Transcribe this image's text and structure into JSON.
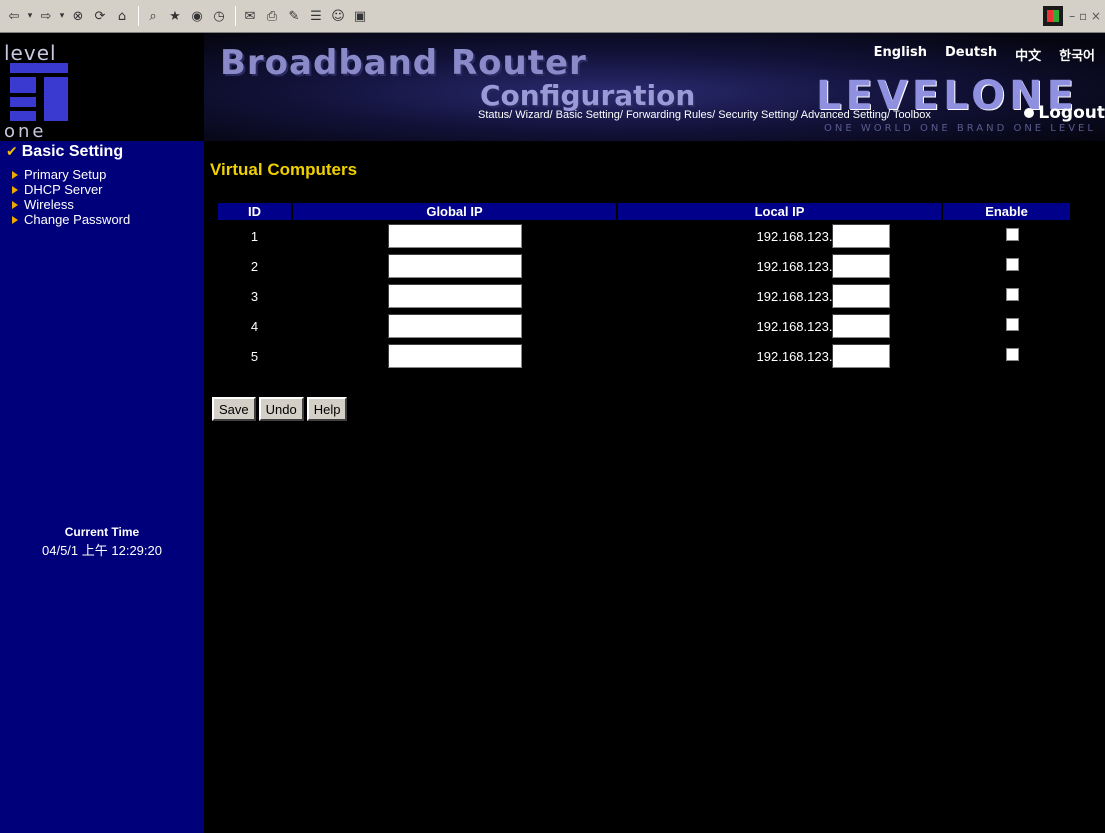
{
  "browser_toolbar": {
    "icons": [
      "back-icon",
      "forward-icon",
      "stop-icon",
      "refresh-icon",
      "home-icon",
      "search-icon",
      "favorites-icon",
      "media-icon",
      "history-icon",
      "mail-icon",
      "print-icon",
      "edit-icon",
      "discuss-icon",
      "messenger-icon",
      "research-icon"
    ],
    "window_controls": "– ▫ ×"
  },
  "logo": {
    "top_text": "level",
    "bottom_text": "one"
  },
  "banner": {
    "title": "Broadband Router",
    "subtitle": "Configuration",
    "brand": "LEVELONE",
    "slogan": "ONE WORLD  ONE BRAND  ONE LEVEL",
    "languages": [
      "English",
      "Deutsh",
      "中文",
      "한국어"
    ],
    "nav_links": "Status/ Wizard/ Basic Setting/ Forwarding Rules/ Security Setting/ Advanced Setting/ Toolbox",
    "logout": "Logout"
  },
  "sidebar": {
    "section_title": "Basic Setting",
    "items": [
      {
        "label": "Primary Setup"
      },
      {
        "label": "DHCP Server"
      },
      {
        "label": "Wireless"
      },
      {
        "label": "Change Password"
      }
    ],
    "current_time_label": "Current Time",
    "current_time_value": "04/5/1 上午 12:29:20"
  },
  "main": {
    "title": "Virtual Computers",
    "columns": [
      "ID",
      "Global IP",
      "Local IP",
      "Enable"
    ],
    "local_ip_prefix": "192.168.123.",
    "rows": [
      {
        "id": "1",
        "global_ip": "",
        "local_ip_suffix": "",
        "enabled": false
      },
      {
        "id": "2",
        "global_ip": "",
        "local_ip_suffix": "",
        "enabled": false
      },
      {
        "id": "3",
        "global_ip": "",
        "local_ip_suffix": "",
        "enabled": false
      },
      {
        "id": "4",
        "global_ip": "",
        "local_ip_suffix": "",
        "enabled": false
      },
      {
        "id": "5",
        "global_ip": "",
        "local_ip_suffix": "",
        "enabled": false
      }
    ],
    "buttons": {
      "save": "Save",
      "undo": "Undo",
      "help": "Help"
    }
  }
}
